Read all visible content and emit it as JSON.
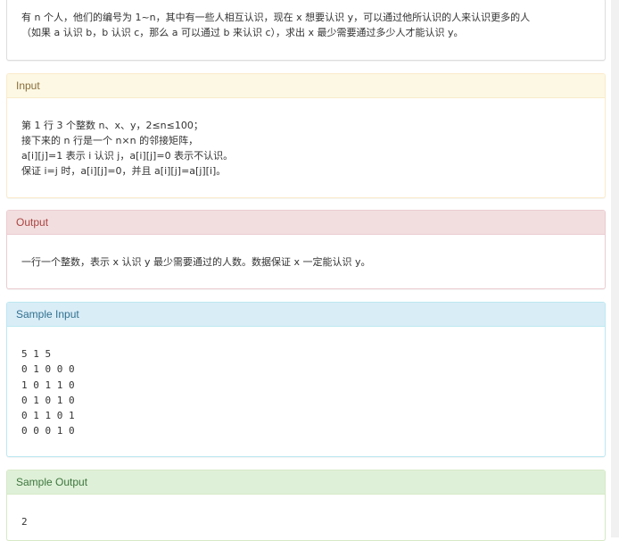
{
  "description": {
    "lines": [
      "有 n 个人，他们的编号为 1~n，其中有一些人相互认识，现在 x 想要认识 y，可以通过他所认识的人来认识更多的人",
      "（如果 a 认识 b，b 认识 c，那么 a 可以通过 b 来认识 c），求出 x 最少需要通过多少人才能认识 y。"
    ]
  },
  "input": {
    "heading": "Input",
    "lines": [
      "第 1 行 3 个整数 n、x、y，2≤n≤100；",
      "接下来的 n 行是一个 n×n 的邻接矩阵，",
      "a[i][j]=1 表示 i 认识 j，a[i][j]=0 表示不认识。",
      "保证 i=j 时，a[i][j]=0，并且 a[i][j]=a[j][i]。"
    ]
  },
  "output": {
    "heading": "Output",
    "lines": [
      "一行一个整数，表示 x 认识 y 最少需要通过的人数。数据保证 x 一定能认识 y。"
    ]
  },
  "sample_input": {
    "heading": "Sample Input",
    "lines": [
      "5 1 5",
      "0 1 0 0 0",
      "1 0 1 1 0",
      "0 1 0 1 0",
      "0 1 1 0 1",
      "0 0 0 1 0"
    ]
  },
  "sample_output": {
    "heading": "Sample Output",
    "lines": [
      "2"
    ]
  }
}
